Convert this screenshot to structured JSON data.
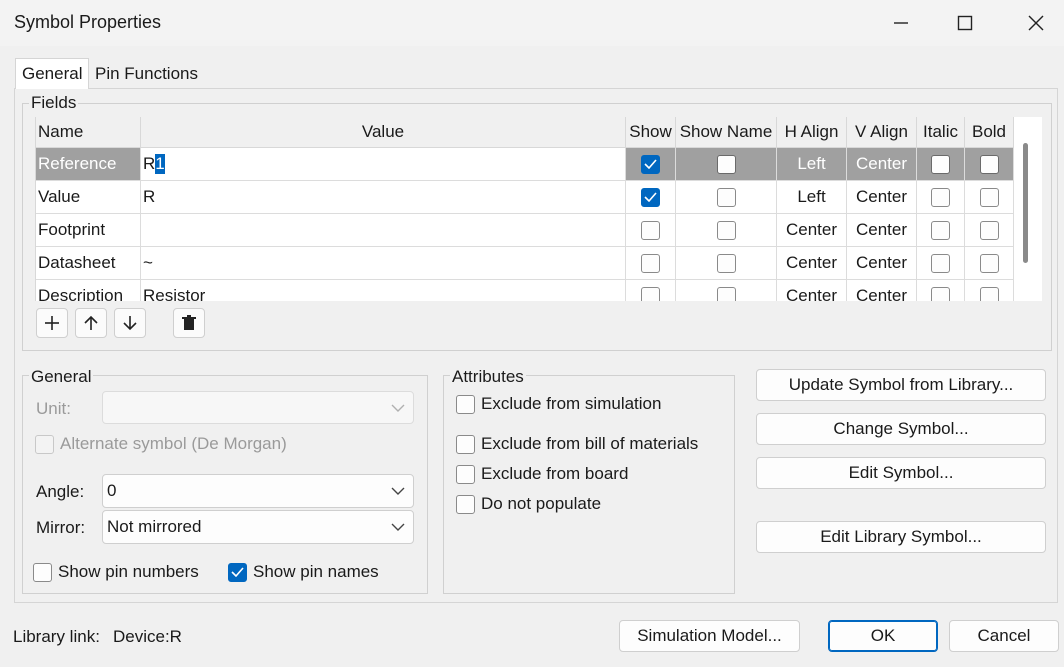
{
  "window": {
    "title": "Symbol Properties"
  },
  "tabs": [
    {
      "label": "General"
    },
    {
      "label": "Pin Functions"
    }
  ],
  "fields": {
    "group_label": "Fields",
    "columns": [
      "Name",
      "Value",
      "Show",
      "Show Name",
      "H Align",
      "V Align",
      "Italic",
      "Bold"
    ],
    "rows": [
      {
        "name": "Reference",
        "value_plain": "R",
        "value_selected": "1",
        "show": true,
        "show_name": false,
        "h_align": "Left",
        "v_align": "Center",
        "italic": false,
        "bold": false
      },
      {
        "name": "Value",
        "value": "R",
        "show": true,
        "show_name": false,
        "h_align": "Left",
        "v_align": "Center",
        "italic": false,
        "bold": false
      },
      {
        "name": "Footprint",
        "value": "",
        "show": false,
        "show_name": false,
        "h_align": "Center",
        "v_align": "Center",
        "italic": false,
        "bold": false
      },
      {
        "name": "Datasheet",
        "value": "~",
        "show": false,
        "show_name": false,
        "h_align": "Center",
        "v_align": "Center",
        "italic": false,
        "bold": false
      },
      {
        "name": "Description",
        "value": "Resistor",
        "show": false,
        "show_name": false,
        "h_align": "Center",
        "v_align": "Center",
        "italic": false,
        "bold": false
      }
    ],
    "toolbar_icons": [
      "plus-icon",
      "arrow-up-icon",
      "arrow-down-icon",
      "trash-icon"
    ]
  },
  "general": {
    "group_label": "General",
    "unit_label": "Unit:",
    "unit_value": "",
    "alternate_label": "Alternate symbol (De Morgan)",
    "alternate_checked": false,
    "angle_label": "Angle:",
    "angle_value": "0",
    "mirror_label": "Mirror:",
    "mirror_value": "Not mirrored",
    "show_pin_numbers_label": "Show pin numbers",
    "show_pin_numbers_checked": false,
    "show_pin_names_label": "Show pin names",
    "show_pin_names_checked": true
  },
  "attributes": {
    "group_label": "Attributes",
    "items": [
      {
        "label": "Exclude from simulation",
        "checked": false
      },
      {
        "label": "Exclude from bill of materials",
        "checked": false
      },
      {
        "label": "Exclude from board",
        "checked": false
      },
      {
        "label": "Do not populate",
        "checked": false
      }
    ]
  },
  "actions": {
    "update_symbol": "Update Symbol from Library...",
    "change_symbol": "Change Symbol...",
    "edit_symbol": "Edit Symbol...",
    "edit_library_symbol": "Edit Library Symbol..."
  },
  "footer": {
    "library_link_label": "Library link:",
    "library_link_value": "Device:R",
    "simulation_model": "Simulation Model...",
    "ok": "OK",
    "cancel": "Cancel"
  },
  "colors": {
    "accent": "#0067c0",
    "selected_row": "#a0a0a0",
    "background": "#f0f0f0"
  }
}
